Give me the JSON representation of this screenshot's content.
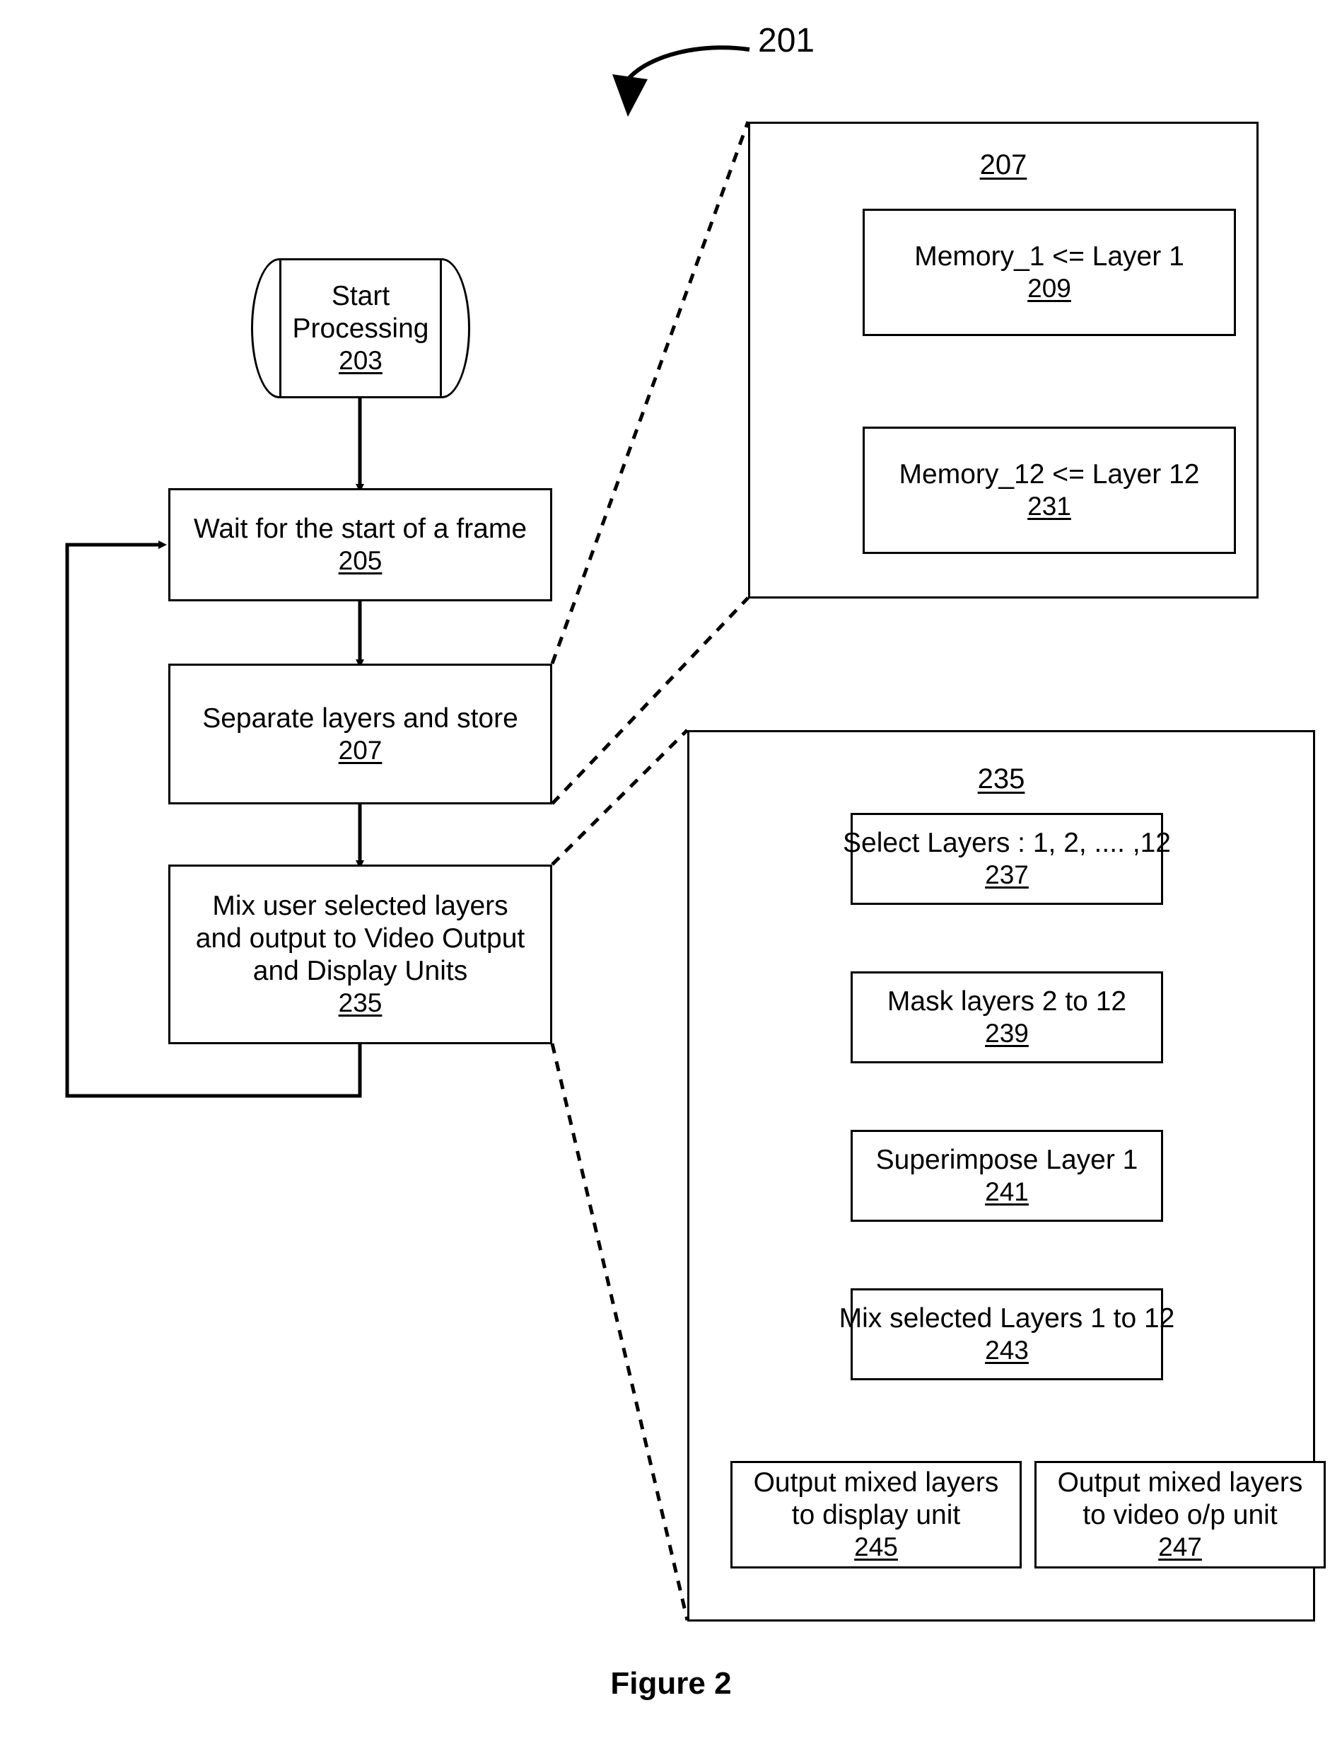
{
  "figure": {
    "caption": "Figure 2",
    "callout_ref": "201"
  },
  "flow": {
    "start": {
      "line1": "Start",
      "line2": "Processing",
      "ref": "203"
    },
    "steps": [
      {
        "line1": "Wait for the start of a frame",
        "ref": "205"
      },
      {
        "line1": "Separate layers and store",
        "ref": "207"
      },
      {
        "line1": "Mix user selected layers",
        "line2": "and output to Video Output",
        "line3": "and Display Units",
        "ref": "235"
      }
    ]
  },
  "panel_207": {
    "ref": "207",
    "boxes": [
      {
        "line1": "Memory_1 <= Layer 1",
        "ref": "209"
      },
      {
        "line1": "Memory_12 <= Layer 12",
        "ref": "231"
      }
    ]
  },
  "panel_235": {
    "ref": "235",
    "boxes": [
      {
        "line1": "Select Layers : 1, 2, .... ,12",
        "ref": "237"
      },
      {
        "line1": "Mask layers 2 to 12",
        "ref": "239"
      },
      {
        "line1": "Superimpose Layer 1",
        "ref": "241"
      },
      {
        "line1": "Mix selected Layers 1 to 12",
        "ref": "243"
      }
    ],
    "outputs": [
      {
        "line1": "Output mixed layers",
        "line2": "to display unit",
        "ref": "245"
      },
      {
        "line1": "Output mixed layers",
        "line2": "to video o/p unit",
        "ref": "247"
      }
    ]
  },
  "colors": {
    "stroke": "#000000",
    "background": "#ffffff"
  }
}
